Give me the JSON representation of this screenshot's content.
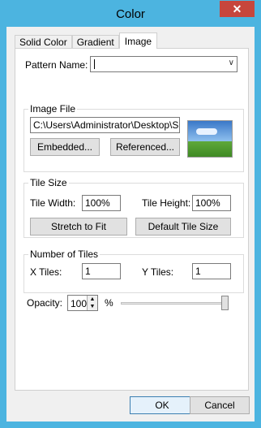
{
  "window": {
    "title": "Color",
    "close_glyph": "✕"
  },
  "tabs": [
    {
      "label": "Solid Color",
      "active": false
    },
    {
      "label": "Gradient",
      "active": false
    },
    {
      "label": "Image",
      "active": true
    }
  ],
  "pattern": {
    "label": "Pattern Name:",
    "value": ""
  },
  "image_file": {
    "group_title": "Image File",
    "path": "C:\\Users\\Administrator\\Desktop\\Spring",
    "embedded_label": "Embedded...",
    "referenced_label": "Referenced..."
  },
  "tile_size": {
    "group_title": "Tile Size",
    "width_label": "Tile Width:",
    "width_value": "100%",
    "height_label": "Tile Height:",
    "height_value": "100%",
    "stretch_label": "Stretch to Fit",
    "default_label": "Default Tile Size"
  },
  "tiles": {
    "group_title": "Number of Tiles",
    "x_label": "X Tiles:",
    "x_value": "1",
    "y_label": "Y Tiles:",
    "y_value": "1"
  },
  "opacity": {
    "label": "Opacity:",
    "value": "100",
    "unit": "%",
    "slider_fraction": 1.0
  },
  "footer": {
    "ok_label": "OK",
    "cancel_label": "Cancel"
  },
  "colors": {
    "titlebar": "#4cb4e0",
    "close": "#c7463c",
    "dialog_bg": "#f0f0f0"
  }
}
